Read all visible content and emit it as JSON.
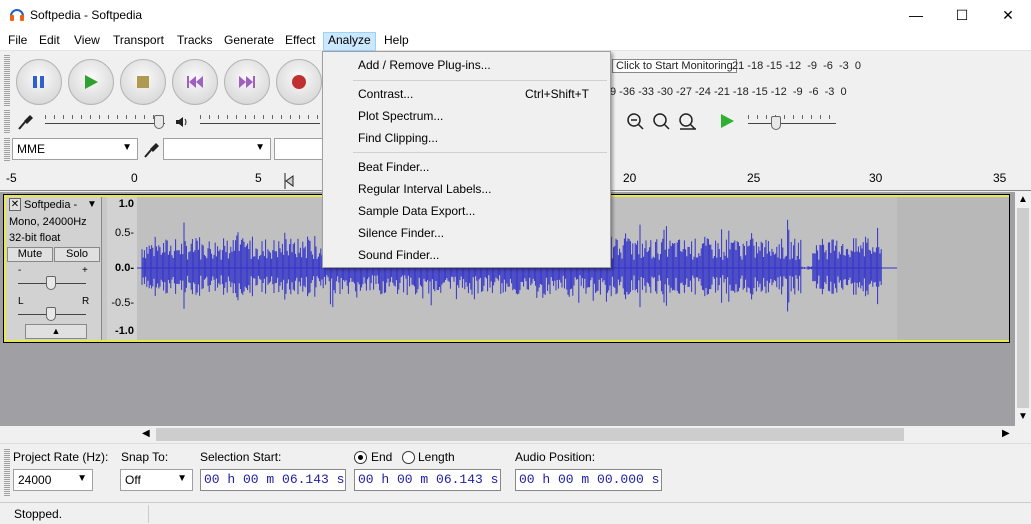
{
  "window": {
    "title": "Softpedia - Softpedia",
    "minimize_glyph": "—",
    "maximize_glyph": "☐",
    "close_glyph": "✕"
  },
  "menubar": [
    "File",
    "Edit",
    "View",
    "Transport",
    "Tracks",
    "Generate",
    "Effect",
    "Analyze",
    "Help"
  ],
  "analyze_menu": {
    "items": [
      {
        "label": "Add / Remove Plug-ins...",
        "shortcut": ""
      },
      {
        "label": "Contrast...",
        "shortcut": "Ctrl+Shift+T"
      },
      {
        "label": "Plot Spectrum...",
        "shortcut": ""
      },
      {
        "label": "Find Clipping...",
        "shortcut": ""
      },
      {
        "label": "Beat Finder...",
        "shortcut": ""
      },
      {
        "label": "Regular Interval Labels...",
        "shortcut": ""
      },
      {
        "label": "Sample Data Export...",
        "shortcut": ""
      },
      {
        "label": "Silence Finder...",
        "shortcut": ""
      },
      {
        "label": "Sound Finder...",
        "shortcut": ""
      }
    ]
  },
  "toolbar": {
    "monitor_label": "Click to Start Monitoring",
    "record_meter_ticks": "21 -18 -15 -12  -9  -6  -3  0",
    "play_meter_ticks": "9 -36 -33 -30 -27 -24 -21 -18 -15 -12  -9  -6  -3  0",
    "host": "MME"
  },
  "ruler": [
    "-5",
    "0",
    "5",
    "20",
    "25",
    "30",
    "35"
  ],
  "track": {
    "name": "Softpedia -",
    "info1": "Mono, 24000Hz",
    "info2": "32-bit float",
    "mute": "Mute",
    "solo": "Solo",
    "gain_minus": "-",
    "gain_plus": "+",
    "pan_left": "L",
    "pan_right": "R",
    "scale": [
      "1.0",
      "0.5-",
      "0.0-",
      "-0.5-",
      "-1.0"
    ],
    "collapse_glyph": "▲"
  },
  "selection": {
    "project_rate_label": "Project Rate (Hz):",
    "project_rate": "24000",
    "snap_label": "Snap To:",
    "snap_value": "Off",
    "sel_start_label": "Selection Start:",
    "end_label": "End",
    "length_label": "Length",
    "audio_pos_label": "Audio Position:",
    "sel_start": "00 h 00 m 06.143 s",
    "sel_end": "00 h 00 m 06.143 s",
    "audio_pos": "00 h 00 m 00.000 s"
  },
  "status": "Stopped."
}
